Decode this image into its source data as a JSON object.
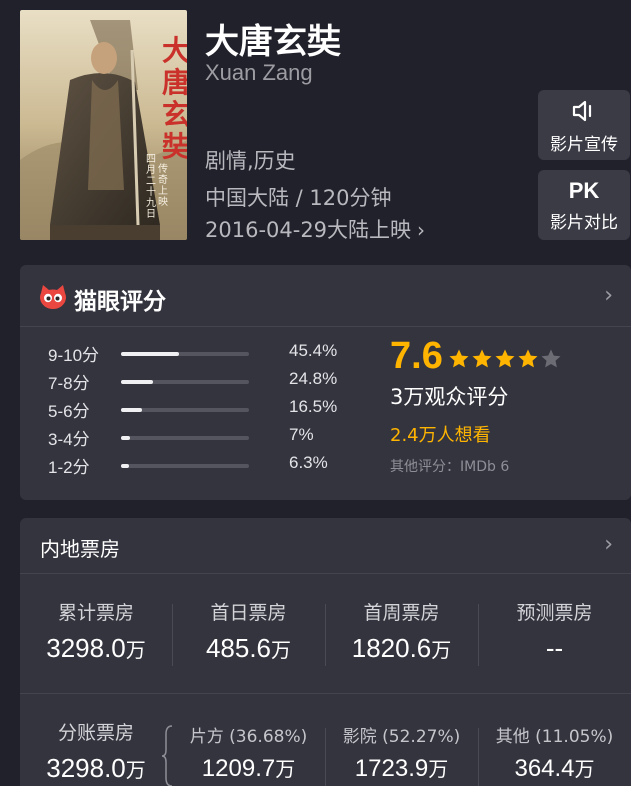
{
  "movie": {
    "title": "大唐玄奘",
    "en_title": "Xuan Zang",
    "genre": "剧情,历史",
    "region_duration": "中国大陆 / 120分钟",
    "release": "2016-04-29大陆上映",
    "poster_title": "大唐玄奘",
    "poster_date": "四月二十九日 传奇上映"
  },
  "side_buttons": {
    "promo_label": "影片宣传",
    "pk_text": "PK",
    "pk_label": "影片对比"
  },
  "rating": {
    "header": "猫眼评分",
    "score": "7.6",
    "stars_filled": 4,
    "stars_total": 5,
    "count": "3万观众评分",
    "wish": "2.4万人想看",
    "other": "其他评分：IMDb 6",
    "distribution": [
      {
        "label": "9-10分",
        "pct": "45.4%",
        "value": 45.4
      },
      {
        "label": "7-8分",
        "pct": "24.8%",
        "value": 24.8
      },
      {
        "label": "5-6分",
        "pct": "16.5%",
        "value": 16.5
      },
      {
        "label": "3-4分",
        "pct": "7%",
        "value": 7
      },
      {
        "label": "1-2分",
        "pct": "6.3%",
        "value": 6.3
      }
    ]
  },
  "box_office": {
    "header": "内地票房",
    "unit": "万",
    "stats": [
      {
        "label": "累计票房",
        "value": "3298.0"
      },
      {
        "label": "首日票房",
        "value": "485.6"
      },
      {
        "label": "首周票房",
        "value": "1820.6"
      },
      {
        "label": "预测票房",
        "value": "--"
      }
    ],
    "split": {
      "label": "分账票房",
      "value": "3298.0"
    },
    "split_parts": [
      {
        "label": "片方 (36.68%)",
        "value": "1209.7"
      },
      {
        "label": "影院 (52.27%)",
        "value": "1723.9"
      },
      {
        "label": "其他 (11.05%)",
        "value": "364.4"
      }
    ]
  },
  "colors": {
    "background": "#21212b",
    "card": "#34343e",
    "accent": "#ffb400",
    "logo_red": "#e9473f"
  }
}
